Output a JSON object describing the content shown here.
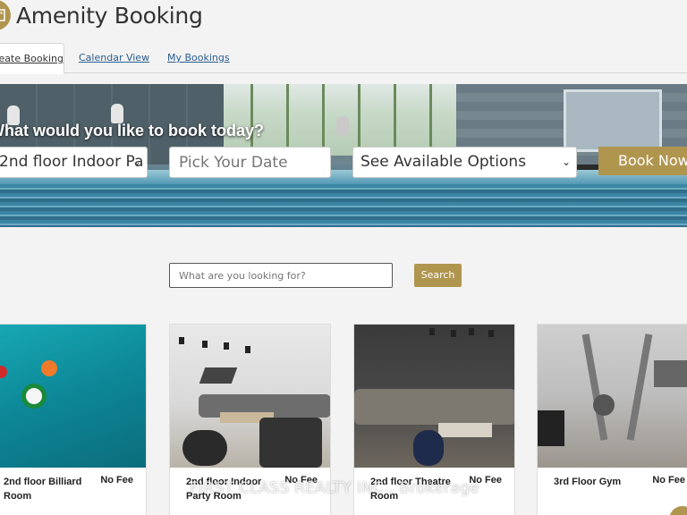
{
  "header": {
    "title": "Amenity Booking"
  },
  "tabs": [
    {
      "label": "Create Booking"
    },
    {
      "label": "Calendar View"
    },
    {
      "label": "My Bookings"
    }
  ],
  "hero": {
    "heading": "What would you like to book today?",
    "amenity_select_value": "2nd floor Indoor Pa",
    "date_placeholder": "Pick Your Date",
    "options_select_value": "See Available Options",
    "book_button": "Book Now"
  },
  "search": {
    "placeholder": "What are you looking for?",
    "button": "Search"
  },
  "cards": [
    {
      "name": "2nd floor Billiard Room",
      "fee": "No Fee"
    },
    {
      "name": "2nd floor Indoor Party Room",
      "fee": "No Fee"
    },
    {
      "name": "2nd floor Theatre Room",
      "fee": "No Fee"
    },
    {
      "name": "3rd Floor Gym",
      "fee": "No Fee"
    }
  ],
  "watermark": "FIRST CLASS REALTY INC., Brokerage",
  "colors": {
    "accent": "#b0954f",
    "link": "#2a5d8f"
  }
}
